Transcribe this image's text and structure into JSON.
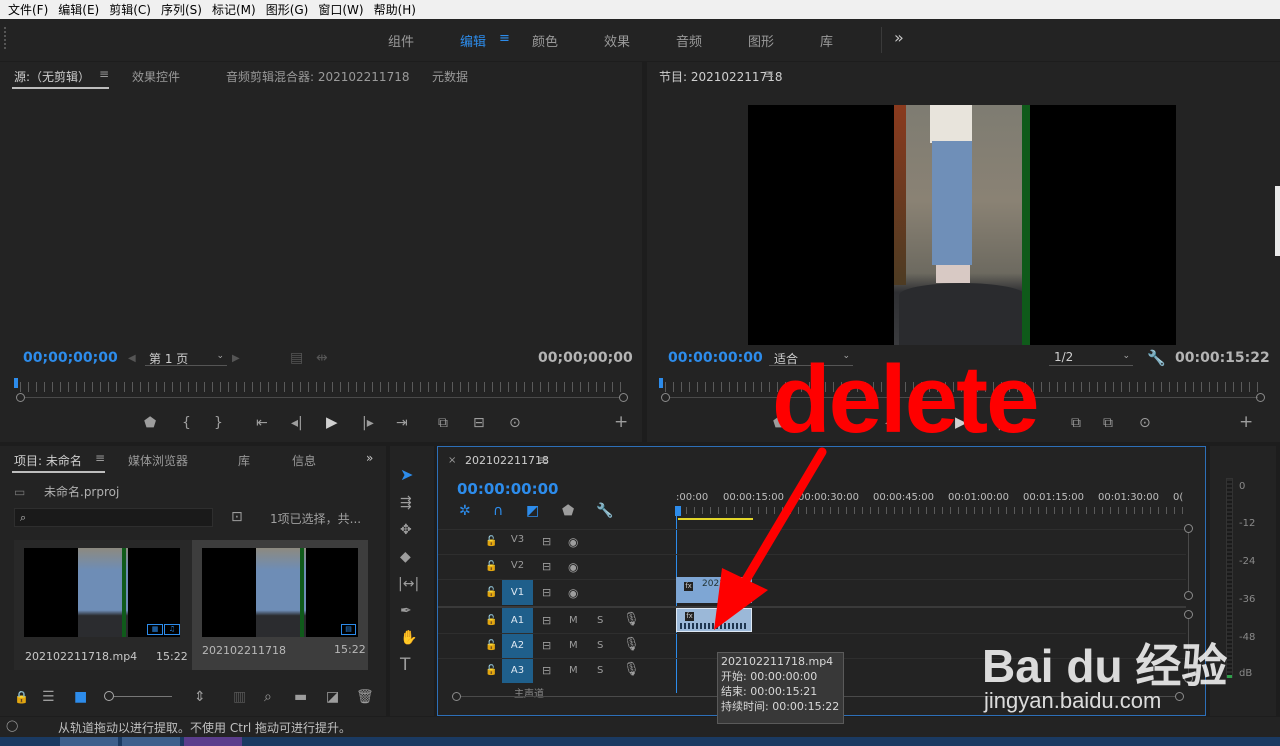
{
  "menu": [
    "文件(F)",
    "编辑(E)",
    "剪辑(C)",
    "序列(S)",
    "标记(M)",
    "图形(G)",
    "窗口(W)",
    "帮助(H)"
  ],
  "workspaces": {
    "items": [
      "组件",
      "编辑",
      "颜色",
      "效果",
      "音频",
      "图形",
      "库"
    ],
    "active": "编辑",
    "overflow": "»"
  },
  "source_panel": {
    "tabs": [
      "源:（无剪辑）",
      "效果控件",
      "音频剪辑混合器: 202102211718",
      "元数据"
    ],
    "timecode_left": "00;00;00;00",
    "page_select": "第 1 页",
    "timecode_right": "00;00;00;00"
  },
  "program_panel": {
    "title": "节目: 202102211718",
    "timecode_left": "00:00:00:00",
    "fit_select": "适合",
    "resolution_select": "1/2",
    "timecode_right": "00:00:15:22"
  },
  "project_panel": {
    "tabs": [
      "项目: 未命名",
      "媒体浏览器",
      "库",
      "信息"
    ],
    "project_file": "未命名.prproj",
    "selection_info": "1项已选择，共...",
    "items": [
      {
        "name": "202102211718.mp4",
        "duration": "15:22"
      },
      {
        "name": "202102211718",
        "duration": "15:22"
      }
    ]
  },
  "timeline": {
    "sequence_name": "202102211718",
    "timecode": "00:00:00:00",
    "ruler_labels": [
      ":00:00",
      "00:00:15:00",
      "00:00:30:00",
      "00:00:45:00",
      "00:01:00:00",
      "00:01:15:00",
      "00:01:30:00",
      "0("
    ],
    "tracks": [
      {
        "name": "V3",
        "kind": "video",
        "target": false
      },
      {
        "name": "V2",
        "kind": "video",
        "target": false
      },
      {
        "name": "V1",
        "kind": "video",
        "target": true
      },
      {
        "name": "A1",
        "kind": "audio",
        "target": true
      },
      {
        "name": "A2",
        "kind": "audio",
        "target": true
      },
      {
        "name": "A3",
        "kind": "audio",
        "target": true
      }
    ],
    "mix_label": "主声道",
    "video_clip_label": "2021",
    "tooltip": {
      "name": "202102211718.mp4",
      "start": "开始: 00:00:00:00",
      "end": "结束: 00:00:15:21",
      "duration": "持续时间: 00:00:15:22"
    }
  },
  "meter_labels": [
    "0",
    "-12",
    "-24",
    "-36",
    "-48",
    "dB"
  ],
  "annotation": {
    "text": "delete",
    "color": "#ff0000"
  },
  "watermark": {
    "brand": "Bai du 经验",
    "url": "jingyan.baidu.com"
  },
  "status": "从轨道拖动以进行提取。不使用 Ctrl 拖动可进行提升。"
}
